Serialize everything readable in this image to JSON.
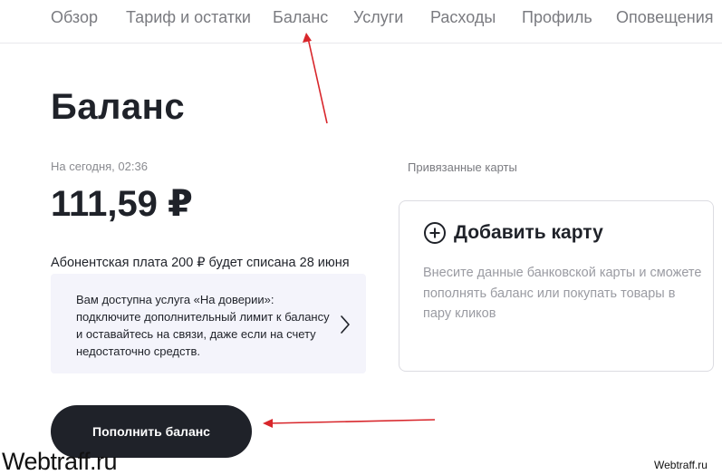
{
  "nav": {
    "items": [
      {
        "label": "Обзор"
      },
      {
        "label": "Тариф и остатки"
      },
      {
        "label": "Баланс"
      },
      {
        "label": "Услуги"
      },
      {
        "label": "Расходы"
      },
      {
        "label": "Профиль"
      },
      {
        "label": "Оповещения"
      }
    ]
  },
  "page": {
    "title": "Баланс"
  },
  "balance": {
    "date_label": "На сегодня, 02:36",
    "amount": "111,59 ₽",
    "fee_notice": "Абонентская плата 200 ₽ будет списана 28 июня"
  },
  "trust_service": {
    "text": "Вам доступна услуга «На доверии»: подключите дополнительный лимит к балансу и оставайтесь на связи, даже если на счету недостаточно средств.",
    "icon": "chevron-right-icon"
  },
  "cards": {
    "section_label": "Привязанные карты",
    "add_title": "Добавить карту",
    "add_icon": "plus-circle-icon",
    "add_description": "Внесите данные банковской карты и сможете пополнять баланс или покупать товары в пару кликов"
  },
  "actions": {
    "topup_label": "Пополнить баланс"
  },
  "annotations": {
    "arrow_color": "#d8262b"
  },
  "watermark": {
    "left": "Webtraff.ru",
    "right": "Webtraff.ru"
  },
  "colors": {
    "primary_dark": "#1f2229",
    "muted_text": "#7a7b80",
    "card_bg": "#f4f4fb"
  }
}
